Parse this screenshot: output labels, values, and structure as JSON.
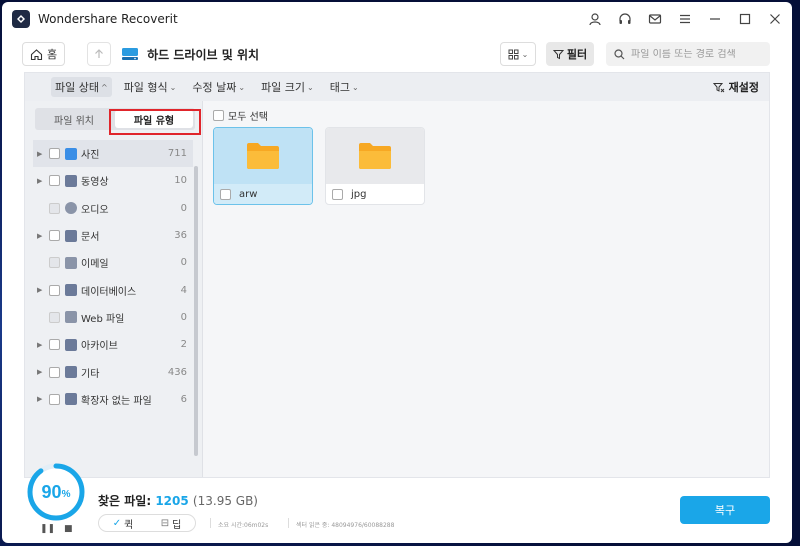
{
  "window": {
    "title": "Wondershare Recoverit"
  },
  "titlebar": {
    "icons": [
      "user-icon",
      "headset-icon",
      "mail-icon",
      "menu-icon",
      "minimize-icon",
      "maximize-icon",
      "close-icon"
    ]
  },
  "nav": {
    "home_label": "홈",
    "path_label": "하드 드라이브 및 위치",
    "filter_label": "필터",
    "search_placeholder": "파일 이름 또는 경로 검색"
  },
  "filterbar": {
    "items": [
      "파일 상태",
      "파일 형식",
      "수정 날짜",
      "파일 크기",
      "태그"
    ],
    "reset_label": "재설정"
  },
  "sidebar": {
    "tabs": [
      "파일 위치",
      "파일 유형"
    ],
    "tree": [
      {
        "label": "사진",
        "count": "711"
      },
      {
        "label": "동영상",
        "count": "10"
      },
      {
        "label": "오디오",
        "count": "0"
      },
      {
        "label": "문서",
        "count": "36"
      },
      {
        "label": "이메일",
        "count": "0"
      },
      {
        "label": "데이터베이스",
        "count": "4"
      },
      {
        "label": "Web 파일",
        "count": "0"
      },
      {
        "label": "아카이브",
        "count": "2"
      },
      {
        "label": "기타",
        "count": "436"
      },
      {
        "label": "확장자 없는 파일",
        "count": "6"
      }
    ]
  },
  "main": {
    "select_all_label": "모두 선택",
    "folders": [
      {
        "name": "arw"
      },
      {
        "name": "jpg"
      }
    ]
  },
  "bottom": {
    "progress_value": "90",
    "progress_unit": "%",
    "progress_fraction": 0.9,
    "found_label": "찾은 파일:",
    "found_count": "1205",
    "found_size": "(13.95 GB)",
    "quick_label": "퀵",
    "deep_label": "딥",
    "elapsed": "소요 시간:06m02s",
    "sectors": "섹터 읽은 중: 48094976/60088288",
    "recover_label": "복구"
  },
  "colors": {
    "accent": "#1aa6e8",
    "highlight": "#e0252b",
    "folder": "#f7a823"
  }
}
